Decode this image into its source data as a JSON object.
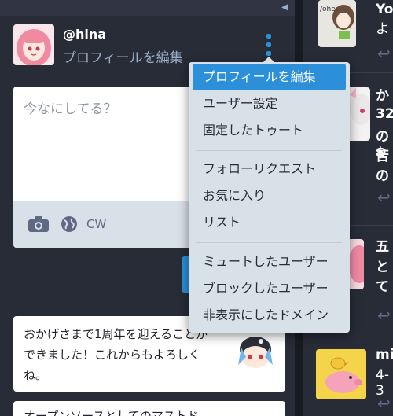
{
  "profile": {
    "handle": "@hina",
    "edit_link": "プロフィールを編集"
  },
  "compose": {
    "placeholder": "今なにしてる？",
    "cw_label": "CW"
  },
  "dropdown": {
    "items": [
      "プロフィールを編集",
      "ユーザー設定",
      "固定したトゥート",
      "フォローリクエスト",
      "お気に入り",
      "リスト",
      "ミュートしたユーザー",
      "ブロックしたユーザー",
      "非表示にしたドメイン"
    ]
  },
  "timeline": {
    "card1_line1": "おかげさまで1周年を迎えることが",
    "card1_line2": "できました！これからもよろしく",
    "card1_line3": "ね。",
    "card2_text": "オープンソースとしてのマストド"
  },
  "right_feed": {
    "item1_line1": "Yo",
    "item1_line2": "よ",
    "item2_line1": "か",
    "item2_line2": "32",
    "item2_line3": "の$",
    "item2_line4": "苦",
    "item2_line5": "の",
    "item3_line1": "五",
    "item3_line2": "と",
    "item3_line3": "て",
    "item4_line1": "mi",
    "item4_line2": "4-3"
  },
  "colors": {
    "accent": "#2b90d9",
    "panel": "#282c37",
    "menu_bg": "#d9e1e8"
  }
}
